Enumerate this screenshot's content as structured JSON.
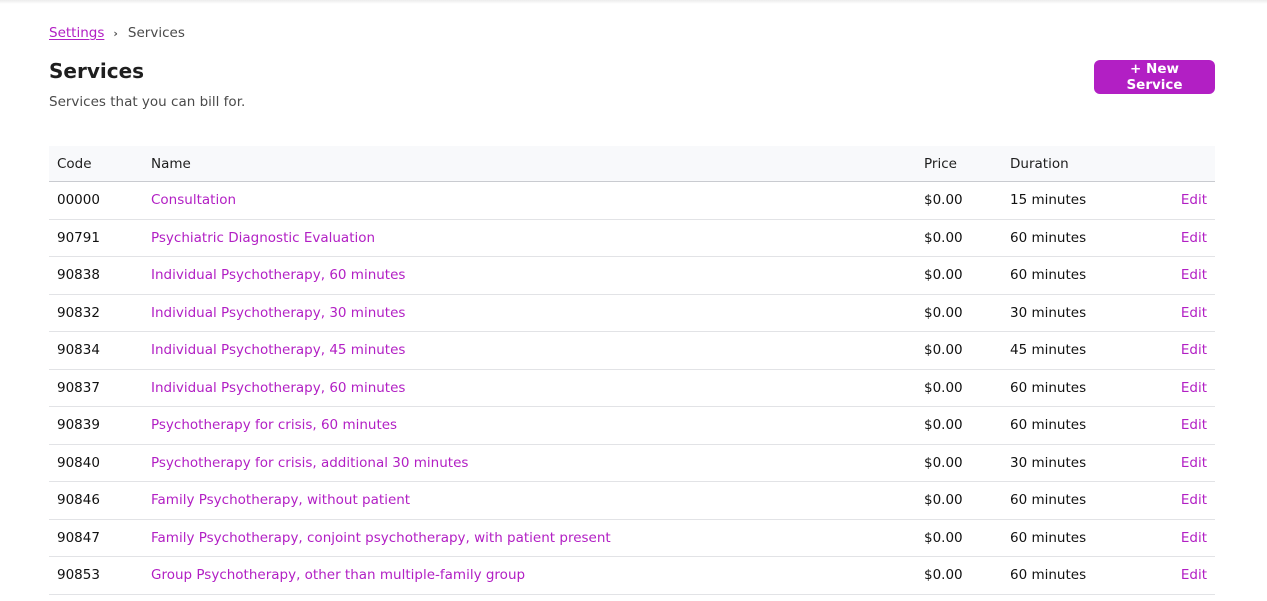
{
  "breadcrumb": {
    "parent": "Settings",
    "separator": "›",
    "current": "Services"
  },
  "header": {
    "title": "Services",
    "subtitle": "Services that you can bill for.",
    "new_button_label": "+ New Service"
  },
  "colors": {
    "accent": "#b21fc4"
  },
  "table": {
    "columns": [
      "Code",
      "Name",
      "Price",
      "Duration",
      ""
    ],
    "edit_label": "Edit",
    "rows": [
      {
        "code": "00000",
        "name": "Consultation",
        "price": "$0.00",
        "duration": "15 minutes"
      },
      {
        "code": "90791",
        "name": "Psychiatric Diagnostic Evaluation",
        "price": "$0.00",
        "duration": "60 minutes"
      },
      {
        "code": "90838",
        "name": "Individual Psychotherapy, 60 minutes",
        "price": "$0.00",
        "duration": "60 minutes"
      },
      {
        "code": "90832",
        "name": "Individual Psychotherapy, 30 minutes",
        "price": "$0.00",
        "duration": "30 minutes"
      },
      {
        "code": "90834",
        "name": "Individual Psychotherapy, 45 minutes",
        "price": "$0.00",
        "duration": "45 minutes"
      },
      {
        "code": "90837",
        "name": "Individual Psychotherapy, 60 minutes",
        "price": "$0.00",
        "duration": "60 minutes"
      },
      {
        "code": "90839",
        "name": "Psychotherapy for crisis, 60 minutes",
        "price": "$0.00",
        "duration": "60 minutes"
      },
      {
        "code": "90840",
        "name": "Psychotherapy for crisis, additional 30 minutes",
        "price": "$0.00",
        "duration": "30 minutes"
      },
      {
        "code": "90846",
        "name": "Family Psychotherapy, without patient",
        "price": "$0.00",
        "duration": "60 minutes"
      },
      {
        "code": "90847",
        "name": "Family Psychotherapy, conjoint psychotherapy, with patient present",
        "price": "$0.00",
        "duration": "60 minutes"
      },
      {
        "code": "90853",
        "name": "Group Psychotherapy, other than multiple-family group",
        "price": "$0.00",
        "duration": "60 minutes"
      }
    ]
  }
}
